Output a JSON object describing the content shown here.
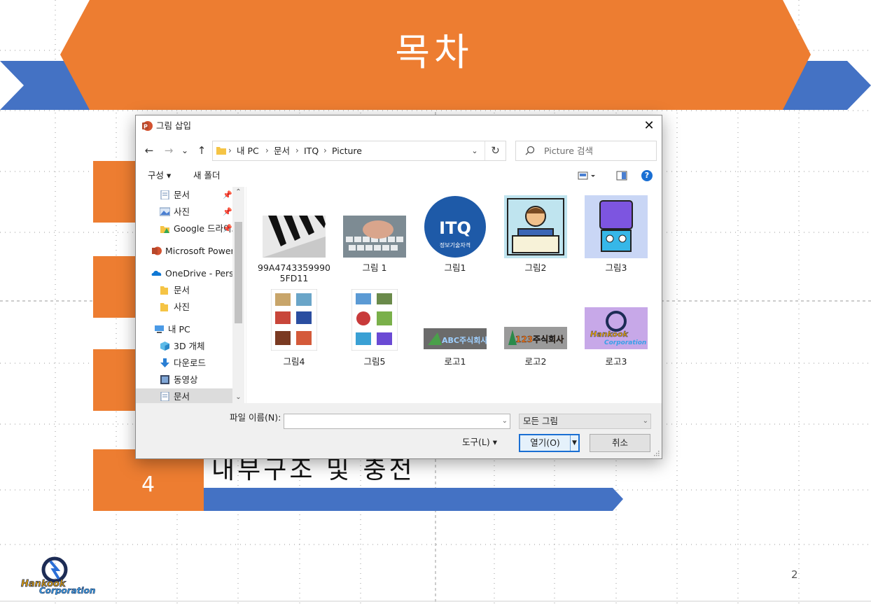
{
  "slide": {
    "title": "목차",
    "item_number": "4",
    "item_text": "내부구조 및 충전",
    "page_number": "2",
    "logo": {
      "line1": "Hankook",
      "line2": "Corporation"
    },
    "colors": {
      "orange": "#ed7d31",
      "blue": "#4472c4"
    }
  },
  "dialog": {
    "title": "그림 삽입",
    "nav": {
      "back": "←",
      "forward": "→",
      "recent": "⌄",
      "up": "↑"
    },
    "breadcrumb": [
      "내 PC",
      "문서",
      "ITQ",
      "Picture"
    ],
    "breadcrumb_sep": "›",
    "search_placeholder": "Picture 검색",
    "toolbar": {
      "organize": "구성 ▾",
      "new_folder": "새 폴더",
      "help": "?"
    },
    "nav_items": [
      {
        "label": "문서",
        "icon": "document-icon",
        "pinned": true
      },
      {
        "label": "사진",
        "icon": "picture-icon",
        "pinned": true
      },
      {
        "label": "Google 드라이브",
        "icon": "google-drive-icon",
        "pinned": true
      },
      {
        "label": "Microsoft PowerPoint",
        "icon": "powerpoint-icon",
        "pinned": false
      },
      {
        "label": "OneDrive - Personal",
        "icon": "onedrive-icon",
        "pinned": false
      },
      {
        "label": "문서",
        "icon": "folder-icon",
        "pinned": false
      },
      {
        "label": "사진",
        "icon": "folder-icon",
        "pinned": false
      },
      {
        "label": "내 PC",
        "icon": "pc-icon",
        "pinned": false
      },
      {
        "label": "3D 개체",
        "icon": "cube-icon",
        "pinned": false
      },
      {
        "label": "다운로드",
        "icon": "download-icon",
        "pinned": false
      },
      {
        "label": "동영상",
        "icon": "video-icon",
        "pinned": false
      },
      {
        "label": "문서",
        "icon": "document-icon",
        "pinned": false
      }
    ],
    "files": [
      {
        "label": "99A47433599905FD11",
        "kind": "piano"
      },
      {
        "label": "그림 1",
        "kind": "keyboard"
      },
      {
        "label": "그림1",
        "kind": "itq-logo",
        "logo_text": "ITQ",
        "logo_sub": "정보기술자격"
      },
      {
        "label": "그림2",
        "kind": "reader"
      },
      {
        "label": "그림3",
        "kind": "robot"
      },
      {
        "label": "그림4",
        "kind": "collage-a"
      },
      {
        "label": "그림5",
        "kind": "collage-b"
      },
      {
        "label": "로고1",
        "kind": "logo-abc",
        "logo_text": "ABC주식회사"
      },
      {
        "label": "로고2",
        "kind": "logo-123",
        "logo_text": "123주식회사"
      },
      {
        "label": "로고3",
        "kind": "logo-hankook",
        "logo_text": "Hankook",
        "logo_sub": "Corporation"
      }
    ],
    "filename_label": "파일 이름(N):",
    "filename_value": "",
    "filter_value": "모든 그림",
    "tools_label": "도구(L)  ▾",
    "open_label": "열기(O)",
    "cancel_label": "취소",
    "accent_color": "#1a6fd3"
  }
}
